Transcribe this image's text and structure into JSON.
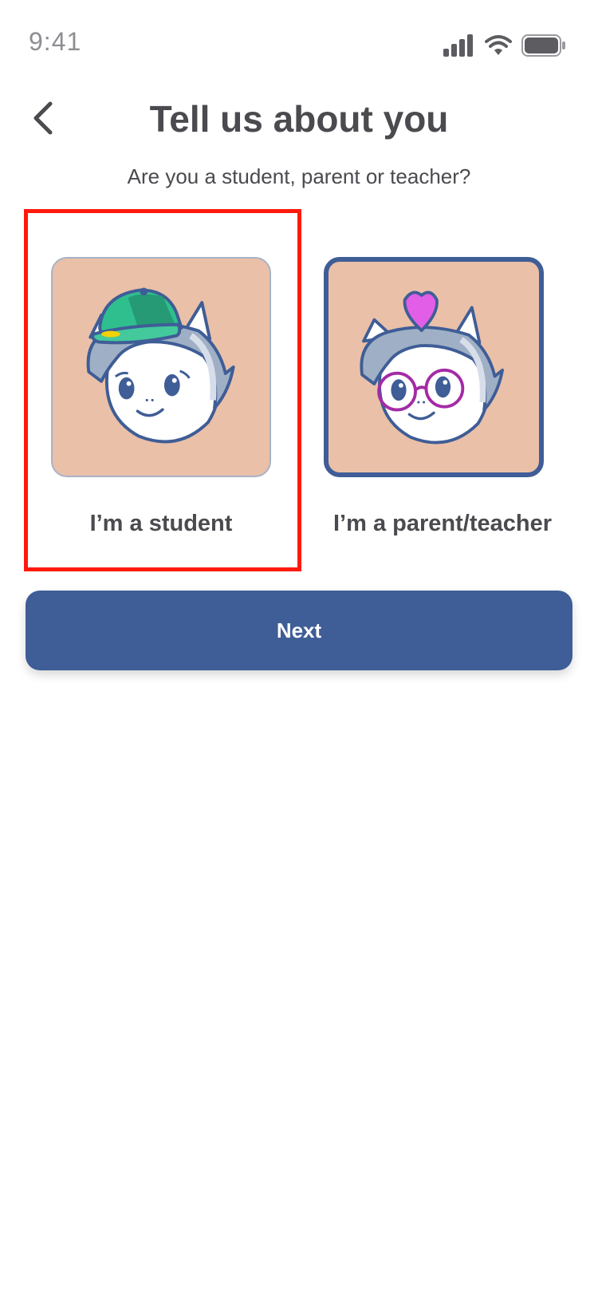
{
  "status_bar": {
    "time": "9:41"
  },
  "header": {
    "title": "Tell us about you",
    "subtitle": "Are you a student, parent or teacher?"
  },
  "options": [
    {
      "label": "I’m a student",
      "icon": "student-avatar-with-cap",
      "selected": true
    },
    {
      "label": "I’m a parent/teacher",
      "icon": "parent-avatar-with-glasses-and-heart",
      "selected": false
    }
  ],
  "actions": {
    "next_label": "Next"
  },
  "colors": {
    "accent": "#3f5d96",
    "tile_bg": "#eac0a9",
    "selection_outline": "#ff1a0d",
    "text": "#4a4a4f"
  }
}
